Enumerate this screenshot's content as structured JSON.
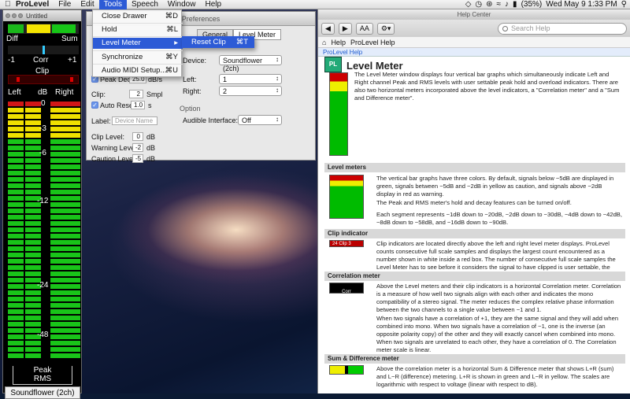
{
  "menubar": {
    "app": "ProLevel",
    "items": [
      "File",
      "Edit",
      "Tools",
      "Speech",
      "Window",
      "Help"
    ],
    "active": "Tools",
    "battery": "(35%)",
    "clock": "Wed May 9  1:33 PM"
  },
  "meter": {
    "title": "Untitled",
    "diff": "Diff",
    "sum": "Sum",
    "minus1": "-1",
    "corr": "Corr",
    "plus1": "+1",
    "clip": "Clip",
    "left": "Left",
    "db": "dB",
    "right": "Right",
    "scale": [
      "0",
      "-3",
      "-6",
      "-12",
      "-24",
      "-48"
    ],
    "peak": "Peak",
    "rms": "RMS",
    "source": "Soundflower (2ch)"
  },
  "tools_menu": {
    "items": [
      {
        "label": "Close Drawer",
        "sc": "⌘D"
      },
      {
        "label": "Hold",
        "sc": "⌘L"
      },
      {
        "label": "Level Meter",
        "sc": "▸"
      },
      {
        "label": "Synchronize",
        "sc": "⌘Y"
      },
      {
        "label": "Audio MIDI Setup...",
        "sc": "⌘U"
      }
    ],
    "sub": {
      "label": "Reset Clip",
      "sc": "⌘T"
    }
  },
  "prefs": {
    "title": "Preferences",
    "tabs": [
      "General",
      "Level Meter"
    ],
    "device_label": "Device:",
    "device": "Soundflower (2ch)",
    "left_label": "Left:",
    "left": "1",
    "right_label": "Right:",
    "right": "2",
    "option": "Option",
    "audible_label": "Audible Interface:",
    "audible": "Off",
    "peak_decay_label": "Peak Decay",
    "peak_decay": "25.0",
    "peak_decay_unit": "dB/s",
    "clip_label": "Clip:",
    "clip": "2",
    "clip_unit": "Smpl",
    "auto_reset": "Auto Reset",
    "auto_val": "1.0",
    "auto_unit": "s",
    "label_label": "Label:",
    "label_ph": "Device Name",
    "clip_level_label": "Clip Level:",
    "clip_level": "0",
    "warn_label": "Warning Level:",
    "warn": "-2",
    "caution_label": "Caution Level:",
    "caution": "-5",
    "db": "dB"
  },
  "help": {
    "title": "Help Center",
    "search_ph": "Search Help",
    "nav_help": "Help",
    "nav_prolevel": "ProLevel Help",
    "crumb": "ProLevel Help",
    "heading": "Level Meter",
    "intro": "The Level Meter window displays four vertical bar graphs which simultaneously indicate Left and Right channel Peak and RMS levels with user settable peak hold and overload indicators. There are also two horizontal meters incorporated above the level indicators, a \"Correlation meter\" and a \"Sum and Difference meter\".",
    "s1": "Level meters",
    "s1p1": "The vertical bar graphs have three colors. By default, signals below −5dB are displayed in green, signals between −5dB and −2dB in yellow as caution, and signals above −2dB display in red as warning.",
    "s1p2": "The Peak and RMS meter's hold and decay features can be turned on/off.",
    "s1p3": "Each segment represents −1dB down to −20dB, −2dB down to −30dB, −4dB down to −42dB, −8dB down to −58dB, and −16dB down to −90dB.",
    "s2": "Clip indicator",
    "s2p": "Clip indicators are located directly above the left and right level meter displays. ProLevel counts consecutive full scale samples and displays the largest count encountered as a number shown in white inside a red box. The number of consecutive full scale samples the Level Meter has to see before it considers the signal to have clipped is user settable, the default value is 2.",
    "s3": "Correlation meter",
    "s3p1": "Above the Level meters and their clip indicators is a horizontal Correlation meter. Correlation is a measure of how well two signals align with each other and indicates the mono compatibility of a stereo signal. The meter reduces the complex relative phase information between the two channels to a single value between −1 and 1.",
    "s3p2": "When two signals have a correlation of +1, they are the same signal and they will add when combined into mono. When two signals have a correlation of −1, one is the inverse (an opposite polarity copy) of the other and they will exactly cancel when combined into mono. When two signals are unrelated to each other, they have a correlation of 0. The Correlation meter scale is linear.",
    "s4": "Sum & Difference meter",
    "s4p": "Above the correlation meter is a horizontal Sum & Difference meter that shows L+R (sum) and L−R (difference) metering. L+R is shown in green and L−R in yellow. The scales are logarithmic with respect to voltage (linear with respect to dB).",
    "thumb_clip": "Clip",
    "thumb_corr": "Corr",
    "thumb_24": "24",
    "thumb_3": "3"
  }
}
